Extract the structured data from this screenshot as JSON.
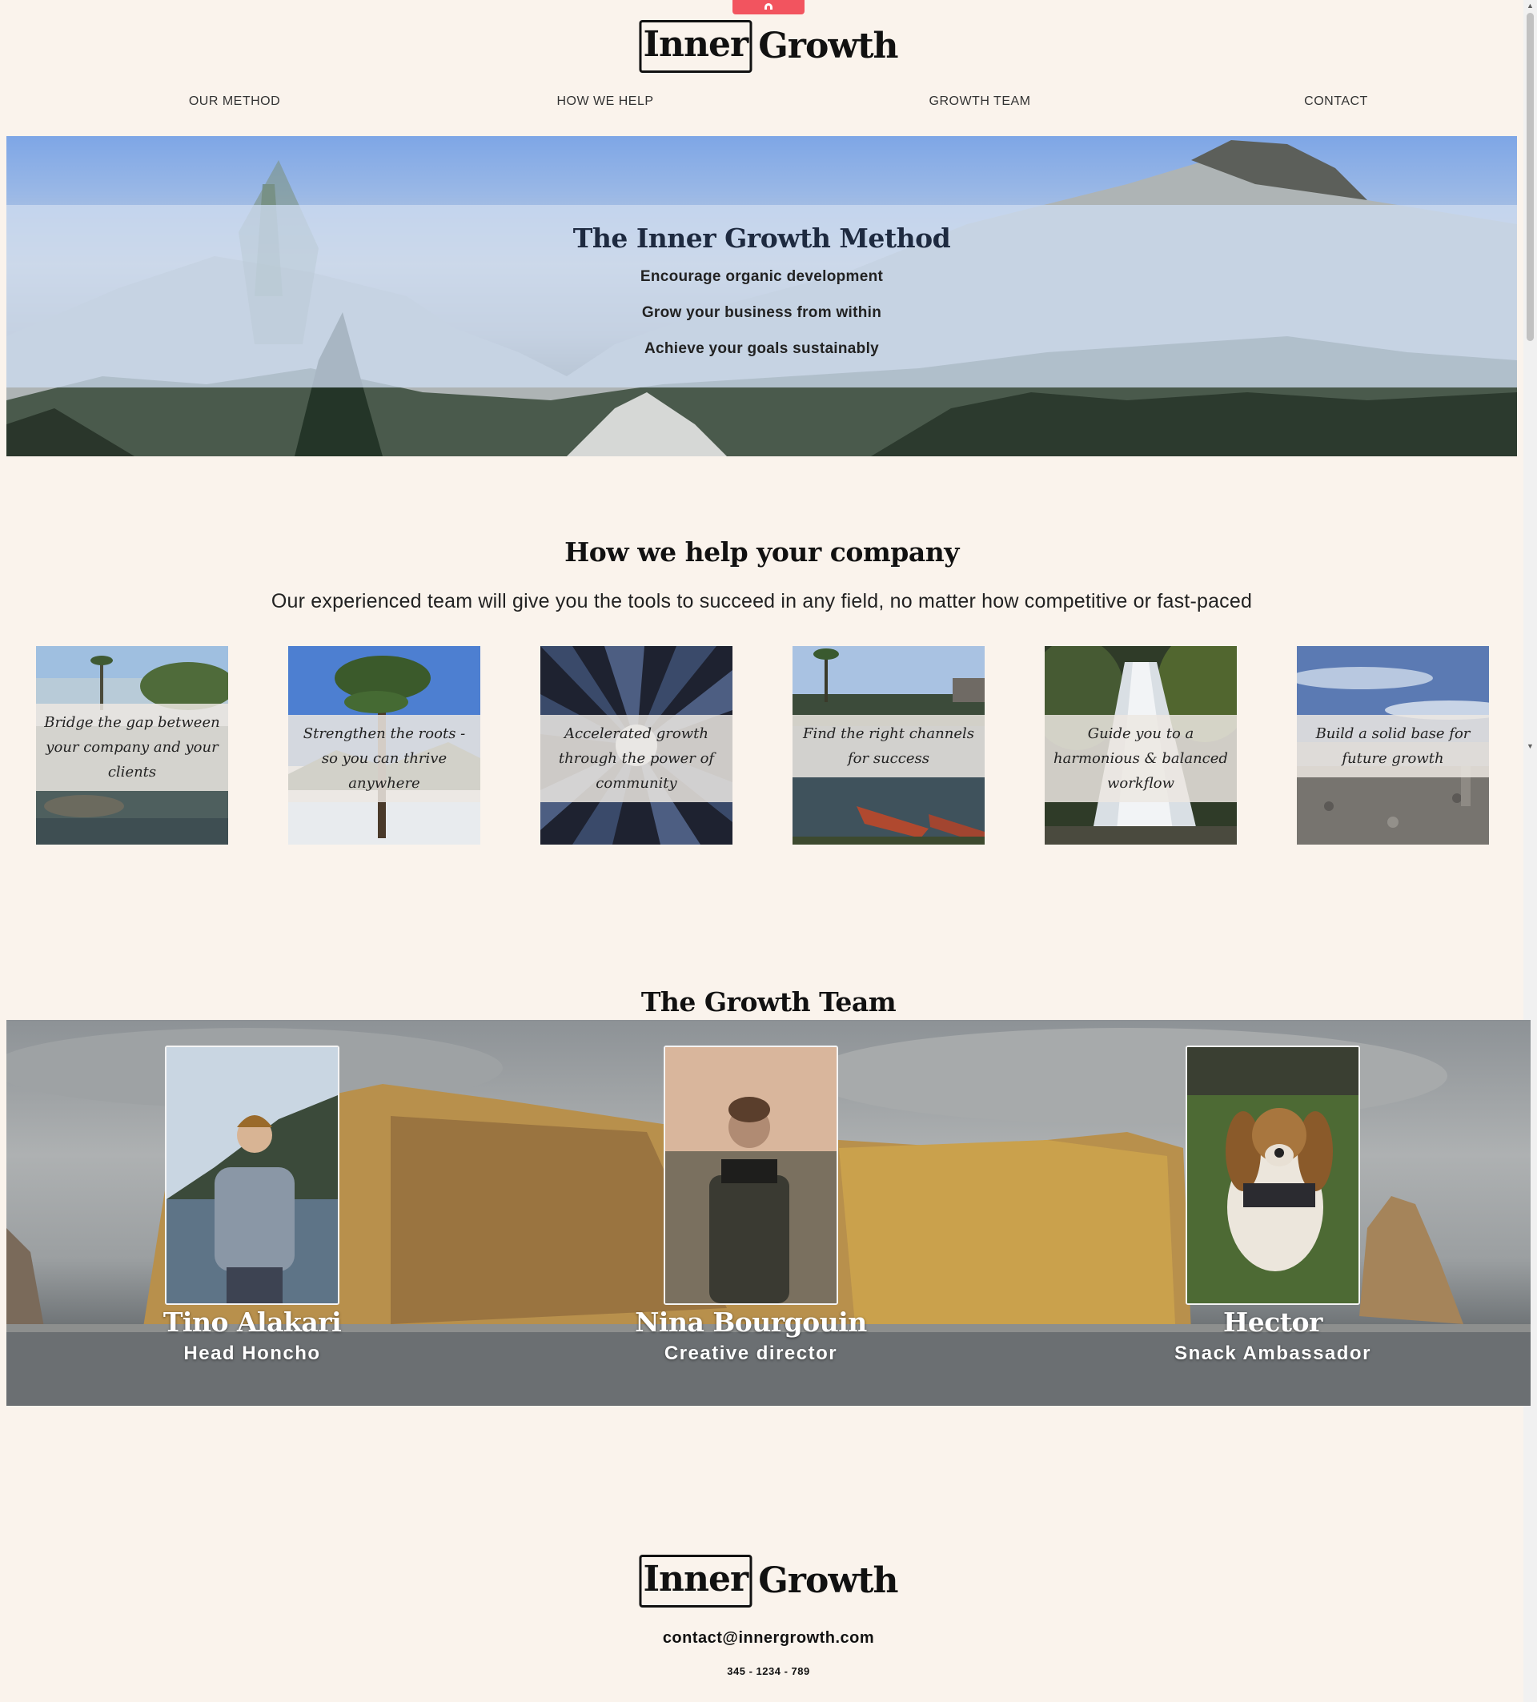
{
  "logo": {
    "boxed": "Inner",
    "plain": "Growth"
  },
  "nav": {
    "items": [
      {
        "label": "OUR METHOD"
      },
      {
        "label": "HOW WE HELP"
      },
      {
        "label": "GROWTH TEAM"
      },
      {
        "label": "CONTACT"
      }
    ]
  },
  "hero": {
    "title": "The Inner Growth Method",
    "lines": [
      "Encourage organic development",
      "Grow your business from within",
      "Achieve your goals sustainably"
    ]
  },
  "how": {
    "title": "How we help your company",
    "subtitle": "Our experienced team will give you the tools to succeed in any field, no matter how competitive or fast-paced",
    "cards": [
      {
        "caption": "Bridge the gap between your company and your clients"
      },
      {
        "caption": "Strengthen the roots - so you can thrive anywhere"
      },
      {
        "caption": "Accelerated growth through the power of community"
      },
      {
        "caption": "Find the right channels for success"
      },
      {
        "caption": "Guide you to a harmonious & balanced workflow"
      },
      {
        "caption": "Build a solid base for future growth"
      }
    ]
  },
  "team": {
    "title": "The Growth Team",
    "members": [
      {
        "name": "Tino Alakari",
        "role": "Head Honcho"
      },
      {
        "name": "Nina Bourgouin",
        "role": "Creative director"
      },
      {
        "name": "Hector",
        "role": "Snack Ambassador"
      }
    ]
  },
  "footer": {
    "email": "contact@innergrowth.com",
    "phone": "345 - 1234 - 789"
  },
  "colors": {
    "background": "#faf3ec",
    "pull_tab": "#f2545f",
    "hero_band": "#cddbf0"
  }
}
